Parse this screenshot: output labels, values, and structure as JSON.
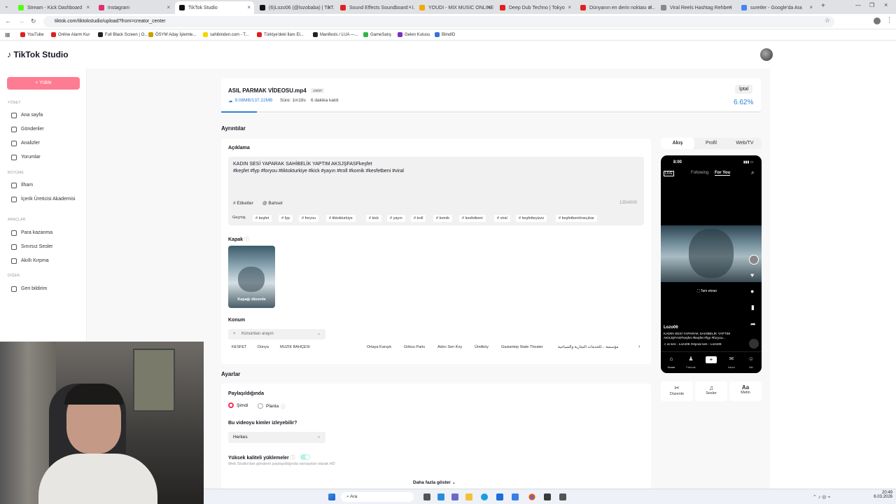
{
  "browser": {
    "tabs": [
      {
        "title": "Stream - Kick Dashboard",
        "color": "#53fc18"
      },
      {
        "title": "Instagram",
        "color": "#e1306c"
      },
      {
        "title": "TikTok Studio",
        "color": "#111111"
      },
      {
        "title": "(6)Lozo06 (@lozobaba) | TikT...",
        "color": "#111111"
      },
      {
        "title": "Sound Effects Soundboard - I...",
        "color": "#e02020"
      },
      {
        "title": "YOUDI - MIX MUSIC ONLINE",
        "color": "#f2a900"
      },
      {
        "title": "Deep Dub Techno | Tokyo",
        "color": "#e02020"
      },
      {
        "title": "Dünyanın en derin noktası ol...",
        "color": "#e02020"
      },
      {
        "title": "Viral Reels Hashtag Rehberi",
        "color": "#888888"
      },
      {
        "title": "suretler - Google'da Ara",
        "color": "#4285f4"
      }
    ],
    "url": "tiktok.com/tiktokstudio/upload?from=creator_center",
    "bookmarks": [
      {
        "label": "YouTube",
        "color": "#e02020"
      },
      {
        "label": "Online Alarm Kur",
        "color": "#e02020"
      },
      {
        "label": "Full Black Screen | O...",
        "color": "#222222"
      },
      {
        "label": "ÖSYM Aday İşlemle...",
        "color": "#c8a000"
      },
      {
        "label": "sahibinden.com - T...",
        "color": "#f5d600"
      },
      {
        "label": "Türkiye'deki İlanı El...",
        "color": "#e02020"
      },
      {
        "label": "Manifests / LUA —...",
        "color": "#222222"
      },
      {
        "label": "GameSatış",
        "color": "#2db54b"
      },
      {
        "label": "Gelen Kutusu",
        "color": "#7b2fbe"
      },
      {
        "label": "BlindID",
        "color": "#3a6fd8"
      }
    ]
  },
  "header": {
    "logo": "TikTok Studio"
  },
  "sidebar": {
    "upload_label": "+  Yükle",
    "sections": [
      {
        "title": "YÖNET",
        "items": [
          "Ana sayfa",
          "Gönderiler",
          "Analizler",
          "Yorumlar"
        ]
      },
      {
        "title": "BÜYÜME",
        "items": [
          "İlham",
          "İçerik Üreticisi Akademisi"
        ]
      },
      {
        "title": "ARAÇLAR",
        "items": [
          "Para kazanma",
          "Sınırsız Sesler",
          "Akıllı Kırpma"
        ]
      },
      {
        "title": "DİĞER",
        "items": [
          "Geri bildirim"
        ]
      }
    ]
  },
  "upload": {
    "filename": "ASIL PARMAK VİDEOSU.mp4",
    "badge": "1080P",
    "size": "9.08MB/137.22MB",
    "duration": "Süre: 1m18s",
    "remaining": "6 dakika kaldı",
    "cancel": "İptal",
    "percent": "6.62%",
    "progress": 0.0662
  },
  "details": {
    "heading": "Ayrıntılar",
    "desc_label": "Açıklama",
    "desc_line1": "KADIN SESİ YAPARAK SAHİBELİK YAPTIM AKSJŞFASFkeşfet",
    "desc_line2": "#keşfet #fyp #foryou #tiktokturkiye #kick #yayın #troll  #komik  #kesfetbeni  #viral",
    "tags_label": "# Etiketler",
    "mention_label": "@ Bahset",
    "char_count": "135/4000",
    "history_label": "Geçmiş",
    "chips": [
      "# keşfet",
      "# fyp",
      "# foryou",
      "# tiktokturkiye",
      "# kick",
      "# yayın",
      "# troll",
      "# komik",
      "# kesfetbeni",
      "# viral",
      "# keşfetteyizzz",
      "# keşfetbeniöneçıkar"
    ],
    "cover_label": "Kapak",
    "cover_edit": "Kapağı düzenle",
    "location_label": "Konum",
    "location_placeholder": "Konumları arayın",
    "locations": [
      "KESFET",
      "Dünya",
      "MÜZİK BAHÇESİ",
      "Ortaya Karışık",
      "Göksu Parkı",
      "Adını Sen Koy",
      "Ümitköy",
      "Gaziantep State Theater",
      "مؤسسة ...للخدمات التجارية والسياحية"
    ]
  },
  "settings": {
    "heading": "Ayarlar",
    "share_label": "Paylaşıldığında",
    "opt_now": "Şimdi",
    "opt_schedule": "Planla",
    "who_label": "Bu videoyu kimler izleyebilir?",
    "who_value": "Herkes",
    "hq_label": "Yüksek kaliteli yüklemeler",
    "hq_desc": "Web Studio'dan gönderin paylaşıldığında varsayılan olarak HD",
    "show_more": "Daha fazla göster"
  },
  "preview": {
    "tabs": [
      "Akış",
      "Profil",
      "Web/TV"
    ],
    "time": "8:00",
    "following": "Following",
    "for_you": "For You",
    "fullscreen": "Tam ekran",
    "username": "Lozo06",
    "caption": "KADIN SESİ YAPARAK SAHİBELİK YAPTIM AKSJŞFASFkeşfet #keşfet #fyp #foryou...",
    "sound": "♫ al ses - Lozo06   Orijinal ses - Lozo06",
    "nav": [
      "Home",
      "Friends",
      "",
      "Inbox",
      "Me"
    ],
    "tools": [
      "Düzenle",
      "Sesler",
      "Metin"
    ]
  },
  "taskbar": {
    "search": "Ara",
    "time": "20:49",
    "date": "6.03.2026"
  }
}
